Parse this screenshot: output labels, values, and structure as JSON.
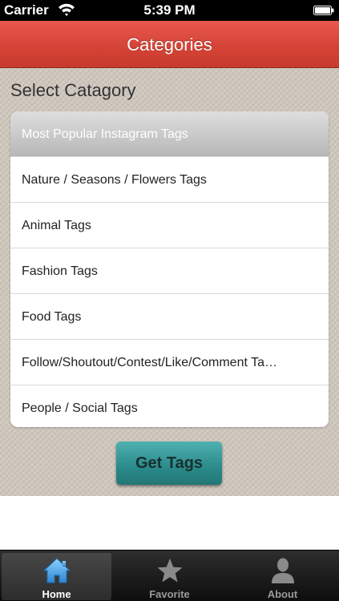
{
  "status_bar": {
    "carrier": "Carrier",
    "time": "5:39 PM"
  },
  "nav": {
    "title": "Categories"
  },
  "content": {
    "heading": "Select Catagory",
    "categories": [
      {
        "label": "Most Popular Instagram Tags",
        "selected": true
      },
      {
        "label": "Nature / Seasons / Flowers Tags",
        "selected": false
      },
      {
        "label": "Animal Tags",
        "selected": false
      },
      {
        "label": "Fashion Tags",
        "selected": false
      },
      {
        "label": "Food Tags",
        "selected": false
      },
      {
        "label": "Follow/Shoutout/Contest/Like/Comment Ta…",
        "selected": false
      },
      {
        "label": "People / Social Tags",
        "selected": false
      }
    ],
    "button_label": "Get Tags"
  },
  "tab_bar": {
    "tabs": [
      {
        "label": "Home",
        "icon": "home-icon",
        "active": true
      },
      {
        "label": "Favorite",
        "icon": "star-icon",
        "active": false
      },
      {
        "label": "About",
        "icon": "person-icon",
        "active": false
      }
    ]
  },
  "colors": {
    "nav_red": "#d44437",
    "content_background": "#cfc7bd",
    "button_teal": "#2b8a8a",
    "tab_active_blue": "#4aa3e8"
  }
}
